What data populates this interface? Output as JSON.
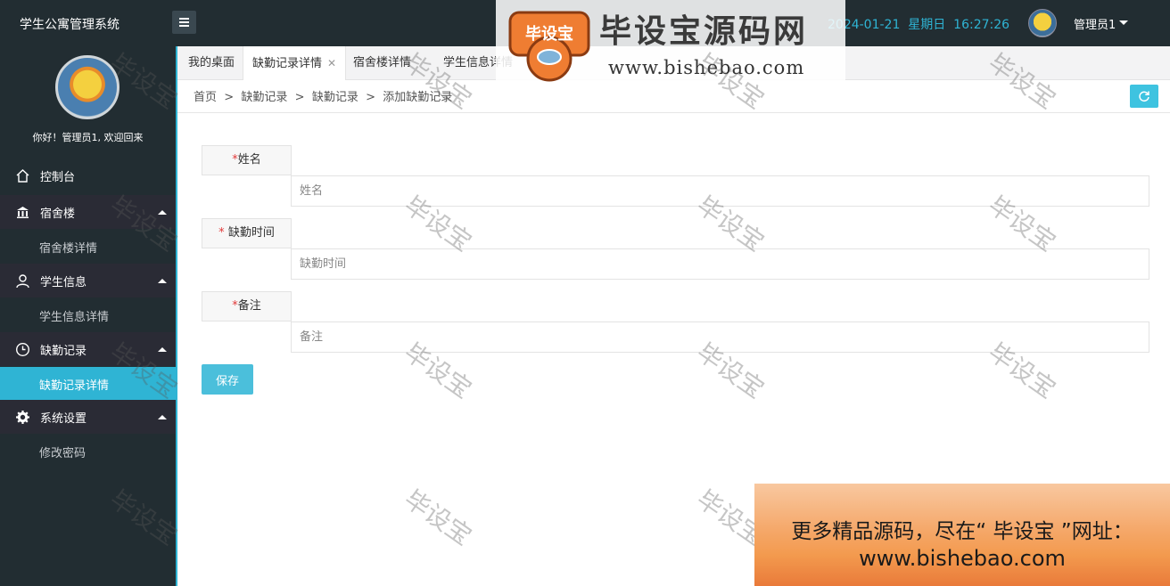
{
  "app": {
    "title": "学生公寓管理系统"
  },
  "header": {
    "datetime": "2024-01-21  星期日  16:27:26",
    "user_name": "管理员1"
  },
  "watermark_logo": {
    "title": "毕设宝源码网",
    "url": "www.bishebao.com",
    "badge": "毕设宝"
  },
  "sidebar": {
    "welcome": "你好！管理员1, 欢迎回来",
    "items": [
      {
        "label": "控制台",
        "icon": "home-icon"
      },
      {
        "label": "宿舍楼",
        "icon": "bank-icon"
      },
      {
        "label": "宿舍楼详情"
      },
      {
        "label": "学生信息",
        "icon": "user-icon"
      },
      {
        "label": "学生信息详情"
      },
      {
        "label": "缺勤记录",
        "icon": "clock-icon"
      },
      {
        "label": "缺勤记录详情"
      },
      {
        "label": "系统设置",
        "icon": "gear-icon"
      },
      {
        "label": "修改密码"
      }
    ]
  },
  "tabs": [
    {
      "label": "我的桌面"
    },
    {
      "label": "缺勤记录详情",
      "close": "✕"
    },
    {
      "label": "宿舍楼详情"
    },
    {
      "label": "学生信息详情"
    }
  ],
  "breadcrumb": "首页  >  缺勤记录  >  缺勤记录  >  添加缺勤记录",
  "form": {
    "fields": [
      {
        "required_mark": "*",
        "label": "姓名",
        "placeholder": "姓名"
      },
      {
        "required_mark": "* ",
        "label": "缺勤时间",
        "placeholder": "缺勤时间"
      },
      {
        "required_mark": "*",
        "label": "备注",
        "placeholder": "备注"
      }
    ],
    "save_label": "保存"
  },
  "watermark_text": "毕设宝",
  "ad": {
    "line1": "更多精品源码，尽在“ 毕设宝 ”网址：",
    "line2": "www.bishebao.com"
  },
  "colors": {
    "accent": "#2fb4d4",
    "sidebar_bg": "#222d32",
    "required": "#e23a3a"
  }
}
